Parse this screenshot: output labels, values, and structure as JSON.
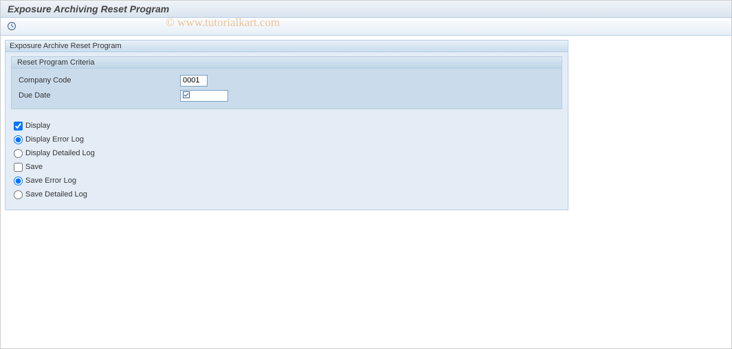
{
  "title": "Exposure Archiving Reset Program",
  "watermark": "© www.tutorialkart.com",
  "panel": {
    "header": "Exposure Archive Reset Program",
    "criteria": {
      "header": "Reset Program Criteria",
      "company_code_label": "Company Code",
      "company_code_value": "0001",
      "due_date_label": "Due Date",
      "due_date_value": ""
    },
    "options": {
      "display_label": "Display",
      "display_checked": true,
      "display_error_log_label": "Display Error Log",
      "display_error_log_selected": true,
      "display_detailed_log_label": "Display Detailed Log",
      "display_detailed_log_selected": false,
      "save_label": "Save",
      "save_checked": false,
      "save_error_log_label": "Save Error Log",
      "save_error_log_selected": true,
      "save_detailed_log_label": "Save Detailed Log",
      "save_detailed_log_selected": false
    }
  }
}
